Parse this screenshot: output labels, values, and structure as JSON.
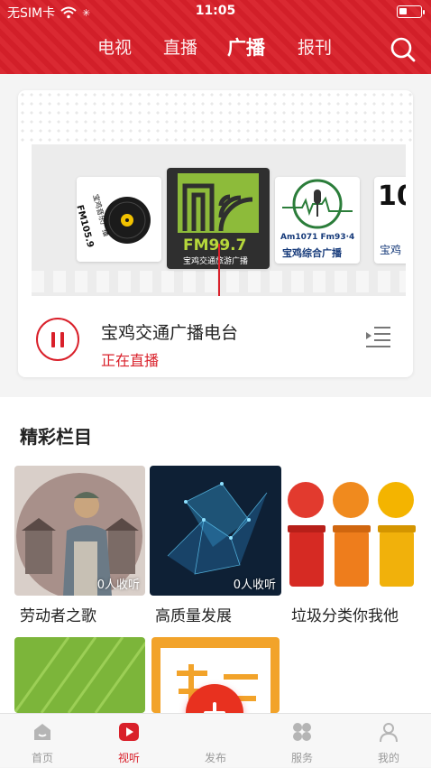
{
  "status_bar": {
    "carrier": "无SIM卡",
    "time": "11:05"
  },
  "top_nav": {
    "tabs": [
      {
        "label": "电视",
        "active": false
      },
      {
        "label": "直播",
        "active": false
      },
      {
        "label": "广播",
        "active": true
      },
      {
        "label": "报刊",
        "active": false
      }
    ],
    "search_icon": "search-icon"
  },
  "radio": {
    "logos": [
      {
        "line1": "FM105.9",
        "line2": "宝鸡音乐广播"
      },
      {
        "line1": "FM99.7",
        "line2": "宝鸡交通旅游广播"
      },
      {
        "line1": "Am1071 Fm93·4",
        "line2": "宝鸡综合广播"
      },
      {
        "line1": "10",
        "line2": "宝鸡"
      }
    ],
    "station_name": "宝鸡交通广播电台",
    "station_status": "正在直播"
  },
  "featured": {
    "title": "精彩栏目",
    "items": [
      {
        "label": "劳动者之歌",
        "count": "0人收听"
      },
      {
        "label": "高质量发展",
        "count": "0人收听"
      },
      {
        "label": "垃圾分类你我他",
        "count": ""
      }
    ]
  },
  "tabbar": {
    "items": [
      {
        "label": "首页",
        "icon": "home-icon"
      },
      {
        "label": "视听",
        "icon": "play-icon"
      },
      {
        "label": "发布",
        "icon": "plus-icon"
      },
      {
        "label": "服务",
        "icon": "grid-icon"
      },
      {
        "label": "我的",
        "icon": "user-icon"
      }
    ],
    "active": "视听"
  },
  "colors": {
    "brand_red": "#d9202a"
  }
}
